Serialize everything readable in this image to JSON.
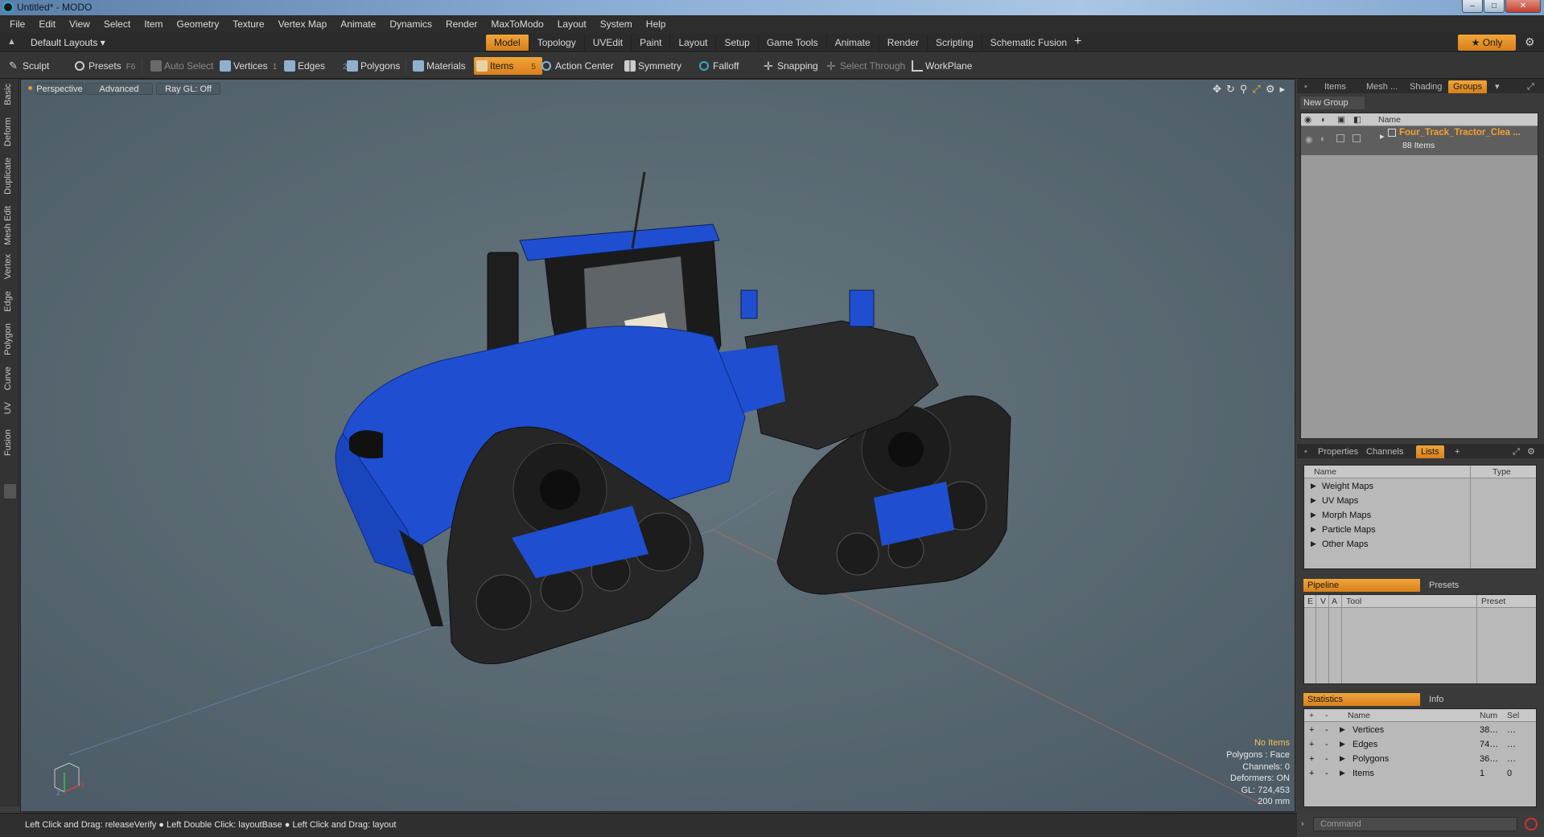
{
  "window": {
    "title": "Untitled* - MODO",
    "minimize": "‒",
    "maximize": "□",
    "close": "✕"
  },
  "menu": [
    "File",
    "Edit",
    "View",
    "Select",
    "Item",
    "Geometry",
    "Texture",
    "Vertex Map",
    "Animate",
    "Dynamics",
    "Render",
    "MaxToModo",
    "Layout",
    "System",
    "Help"
  ],
  "layouts": {
    "label": "Default Layouts ▾"
  },
  "layout_tabs": [
    "Model",
    "Topology",
    "UVEdit",
    "Paint",
    "Layout",
    "Setup",
    "Game Tools",
    "Animate",
    "Render",
    "Scripting",
    "Schematic Fusion"
  ],
  "active_layout_tab": "Model",
  "only_button": "★ Only",
  "toolbar": {
    "sculpt": "Sculpt",
    "presets": "Presets",
    "presets_key": "F6",
    "auto_select": "Auto Select",
    "vertices": "Vertices",
    "vertices_count": "1",
    "edges": "Edges",
    "edges_count": "2",
    "polygons": "Polygons",
    "materials": "Materials",
    "items": "Items",
    "items_count": "5",
    "action_center": "Action Center",
    "symmetry": "Symmetry",
    "falloff": "Falloff",
    "snapping": "Snapping",
    "select_through": "Select Through",
    "workplane": "WorkPlane"
  },
  "left_tabs": [
    "Basic",
    "Deform",
    "Duplicate",
    "Mesh Edit",
    "Vertex",
    "Edge",
    "Polygon",
    "Curve",
    "UV",
    "Fusion"
  ],
  "viewport": {
    "view": "Perspective",
    "shading": "Advanced",
    "raygl": "Ray GL: Off",
    "stats": {
      "selection": "No Items",
      "polygons": "Polygons : Face",
      "channels": "Channels: 0",
      "deformers": "Deformers: ON",
      "gl": "GL: 724,453",
      "scale": "200 mm"
    },
    "colors": {
      "background": "#5b6b76",
      "tractor_body": "#1f4fd0",
      "tracks": "#262626"
    }
  },
  "status": {
    "hint": "Left Click and Drag: releaseVerify ● Left Double Click: layoutBase ● Left Click and Drag: layout"
  },
  "groups_panel": {
    "tabs": [
      "Items",
      "Mesh ...",
      "Shading",
      "Groups"
    ],
    "active_tab": "Groups",
    "new_group": "New Group",
    "col_name": "Name",
    "group_name": "Four_Track_Tractor_Clea ...",
    "group_count": "88 Items"
  },
  "lists_panel": {
    "tabs": [
      "Properties",
      "Channels",
      "Lists"
    ],
    "active_tab": "Lists",
    "col_name": "Name",
    "col_type": "Type",
    "items": [
      "Weight Maps",
      "UV Maps",
      "Morph Maps",
      "Particle Maps",
      "Other Maps"
    ]
  },
  "pipeline_panel": {
    "tab_pipeline": "Pipeline",
    "tab_presets": "Presets",
    "cols": [
      "E",
      "V",
      "A",
      "Tool",
      "Preset"
    ]
  },
  "stats_panel": {
    "tab_statistics": "Statistics",
    "tab_info": "Info",
    "cols": [
      "+",
      "-",
      "Name",
      "Num",
      "Sel"
    ],
    "rows": [
      {
        "name": "Vertices",
        "num": "38…",
        "sel": "…"
      },
      {
        "name": "Edges",
        "num": "74…",
        "sel": "…"
      },
      {
        "name": "Polygons",
        "num": "36…",
        "sel": "…"
      },
      {
        "name": "Items",
        "num": "1",
        "sel": "0"
      }
    ]
  },
  "command": {
    "placeholder": "Command"
  }
}
